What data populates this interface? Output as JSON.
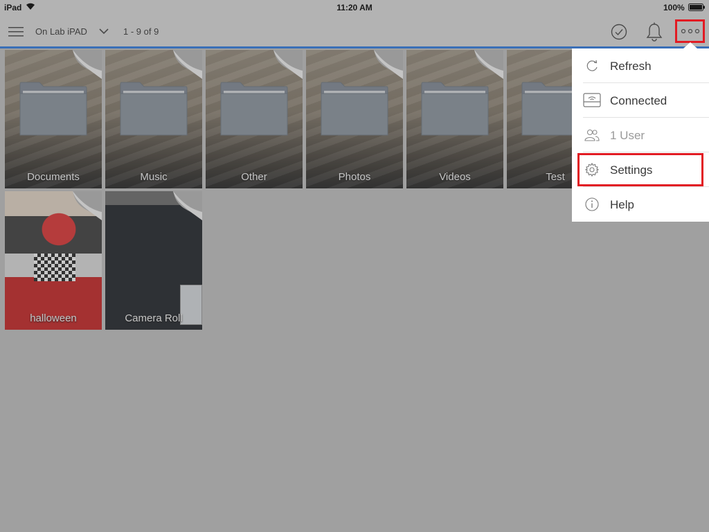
{
  "status_bar": {
    "device": "iPad",
    "time": "11:20 AM",
    "battery": "100%"
  },
  "toolbar": {
    "location": "On Lab iPAD",
    "count": "1 - 9 of 9"
  },
  "folders": [
    {
      "label": "Documents"
    },
    {
      "label": "Music"
    },
    {
      "label": "Other"
    },
    {
      "label": "Photos"
    },
    {
      "label": "Videos"
    },
    {
      "label": "Test"
    }
  ],
  "albums": [
    {
      "label": "halloween"
    },
    {
      "label": "Camera Roll"
    }
  ],
  "menu": {
    "items": [
      {
        "label": "Refresh",
        "icon": "refresh-icon"
      },
      {
        "label": "Connected",
        "icon": "drive-wifi-icon"
      },
      {
        "label": "1 User",
        "icon": "users-icon"
      },
      {
        "label": "Settings",
        "icon": "gear-icon"
      },
      {
        "label": "Help",
        "icon": "info-icon"
      }
    ]
  },
  "colors": {
    "accent": "#3a6fb7",
    "highlight": "#e21b23"
  }
}
